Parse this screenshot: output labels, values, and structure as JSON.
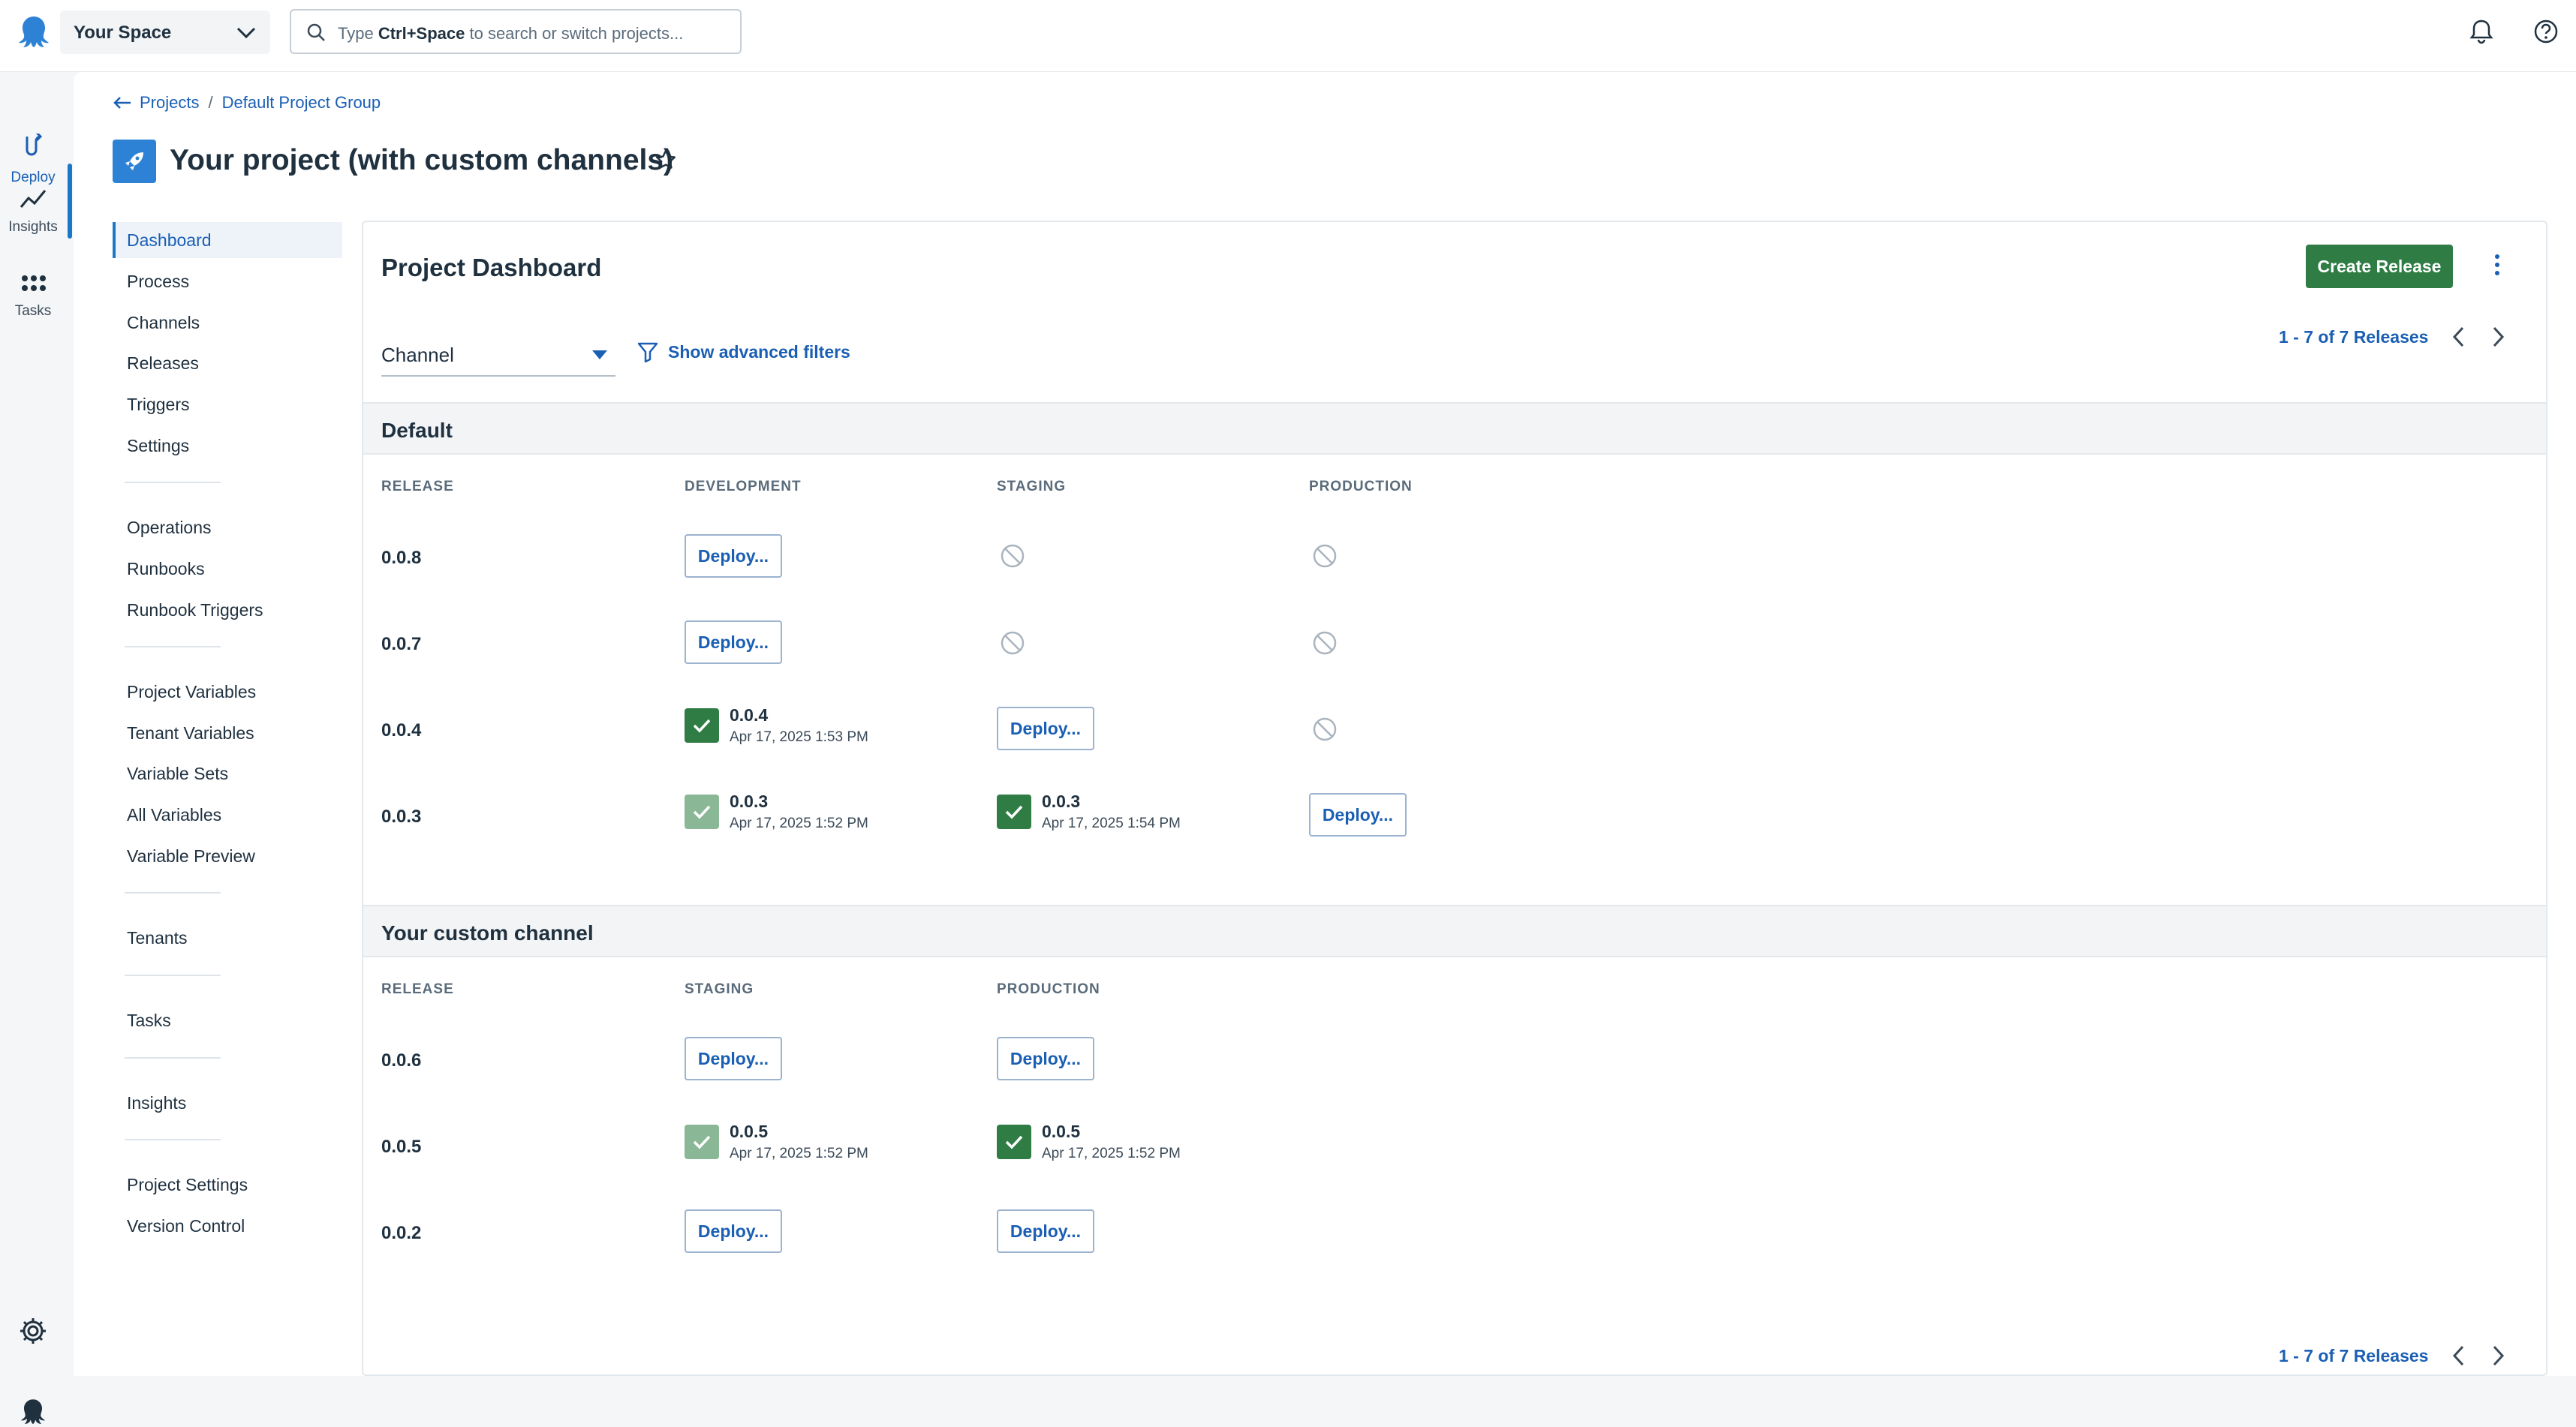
{
  "topbar": {
    "space_name": "Your Space",
    "search_prefix": "Type ",
    "search_shortcut": "Ctrl+Space",
    "search_suffix": " to search or switch projects..."
  },
  "rail": {
    "items": [
      {
        "label": "Deploy",
        "icon": "deploy-icon"
      },
      {
        "label": "Insights",
        "icon": "insights-icon"
      },
      {
        "label": "Tasks",
        "icon": "tasks-icon"
      }
    ]
  },
  "breadcrumb": {
    "projects": "Projects",
    "separator": "/",
    "group": "Default Project Group"
  },
  "project": {
    "title": "Your project (with custom channels)"
  },
  "project_nav": [
    "Dashboard",
    "Process",
    "Channels",
    "Releases",
    "Triggers",
    "Settings",
    "Operations",
    "Runbooks",
    "Runbook Triggers",
    "Project Variables",
    "Tenant Variables",
    "Variable Sets",
    "All Variables",
    "Variable Preview",
    "Tenants",
    "Tasks",
    "Insights",
    "Project Settings",
    "Version Control"
  ],
  "dashboard": {
    "title": "Project Dashboard",
    "create_release": "Create Release",
    "channel_filter": "Channel",
    "advanced_filters": "Show advanced filters",
    "paging": "1 - 7 of 7 Releases",
    "deploy_label": "Deploy...",
    "groups": [
      {
        "name": "Default",
        "columns": [
          "RELEASE",
          "DEVELOPMENT",
          "STAGING",
          "PRODUCTION"
        ],
        "rows": [
          {
            "release": "0.0.8"
          },
          {
            "release": "0.0.7"
          },
          {
            "release": "0.0.4",
            "dev_version": "0.0.4",
            "dev_date": "Apr 17, 2025 1:53 PM"
          },
          {
            "release": "0.0.3",
            "dev_version": "0.0.3",
            "dev_date": "Apr 17, 2025 1:52 PM",
            "stg_version": "0.0.3",
            "stg_date": "Apr 17, 2025 1:54 PM"
          }
        ]
      },
      {
        "name": "Your custom channel",
        "columns": [
          "RELEASE",
          "STAGING",
          "PRODUCTION"
        ],
        "rows": [
          {
            "release": "0.0.6"
          },
          {
            "release": "0.0.5",
            "stg_version": "0.0.5",
            "stg_date": "Apr 17, 2025 1:52 PM",
            "prd_version": "0.0.5",
            "prd_date": "Apr 17, 2025 1:52 PM"
          },
          {
            "release": "0.0.2"
          }
        ]
      }
    ]
  },
  "colors": {
    "accent": "#1a5fb4",
    "success": "#2f7d45",
    "success_light": "#8ab896"
  }
}
